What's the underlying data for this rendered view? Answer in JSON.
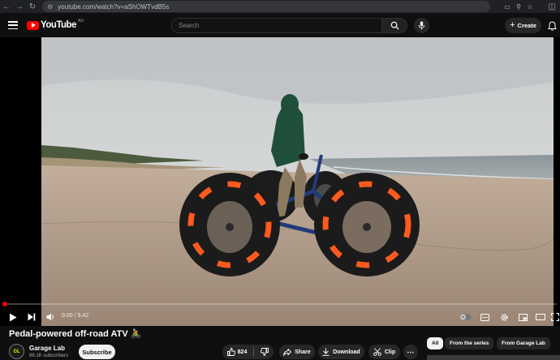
{
  "browser": {
    "url": "youtube.com/watch?v=aShOWTvdB5s"
  },
  "masthead": {
    "logo_text": "YouTube",
    "region": "AU",
    "search_placeholder": "Search",
    "create_label": "Create"
  },
  "player": {
    "time_display": "0:00 / 5:42",
    "progress_fraction": 0.003
  },
  "video": {
    "title": "Pedal-powered off-road ATV 🚴",
    "channel_name": "Garage Lab",
    "channel_initials": "GL",
    "subscribers": "86.1K subscribers",
    "subscribe_label": "Subscribe",
    "like_count": "824",
    "share_label": "Share",
    "download_label": "Download",
    "clip_label": "Clip"
  },
  "chips": [
    {
      "label": "All"
    },
    {
      "label": "From the series"
    },
    {
      "label": "From Garage Lab"
    }
  ],
  "colors": {
    "brand": "#ff0000",
    "background": "#0f0f0f",
    "pill": "#272727"
  },
  "icons": [
    "back-icon",
    "forward-icon",
    "reload-icon",
    "tune-icon",
    "cast-icon",
    "zoom-icon",
    "star-icon",
    "extensions-icon",
    "menu-icon",
    "search-icon",
    "mic-icon",
    "bell-icon",
    "play-icon",
    "next-icon",
    "volume-icon",
    "autoplay-toggle-icon",
    "subtitles-icon",
    "settings-icon",
    "miniplayer-icon",
    "theater-icon",
    "fullscreen-icon",
    "like-icon",
    "dislike-icon",
    "share-icon",
    "download-icon",
    "clip-icon",
    "more-icon"
  ]
}
